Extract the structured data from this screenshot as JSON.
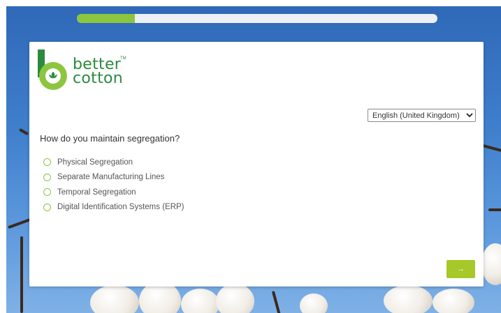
{
  "progress": {
    "value": 0.16,
    "fill_color": "#8cc63f"
  },
  "logo": {
    "line1": "better",
    "line2": "cotton",
    "tm": "TM",
    "color": "#2b8a3e"
  },
  "language": {
    "selected": "English (United Kingdom)"
  },
  "question": "How do you maintain segregation?",
  "options": [
    {
      "label": "Physical Segregation"
    },
    {
      "label": "Separate Manufacturing Lines"
    },
    {
      "label": "Temporal Segregation"
    },
    {
      "label": "Digital Identification Systems (ERP)"
    }
  ],
  "next_button": {
    "label": "→",
    "icon": "arrow-right-icon",
    "color": "#a6c828"
  }
}
